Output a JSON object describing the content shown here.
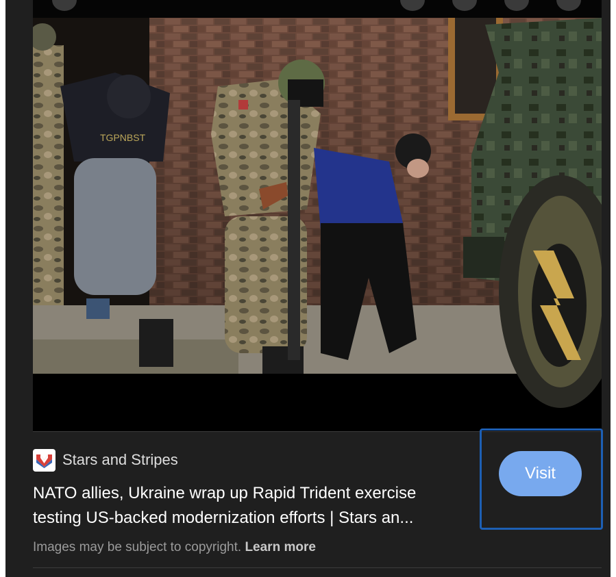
{
  "result": {
    "image_alt": "Soldiers escorting detainees past a brick building next to an armored vehicle",
    "source": {
      "name": "Stars and Stripes",
      "favicon": "stars-and-stripes-logo-icon"
    },
    "title_line1": "NATO allies, Ukraine wrap up Rapid Trident exercise",
    "title_line2": "testing US-backed modernization efforts | Stars an...",
    "visit_label": "Visit",
    "copyright_text": "Images may be subject to copyright.",
    "learn_more_label": "Learn more"
  },
  "colors": {
    "panel_bg": "#1f1f1f",
    "visit_button": "#78a9ee",
    "focus_ring": "#1d5fb4"
  }
}
